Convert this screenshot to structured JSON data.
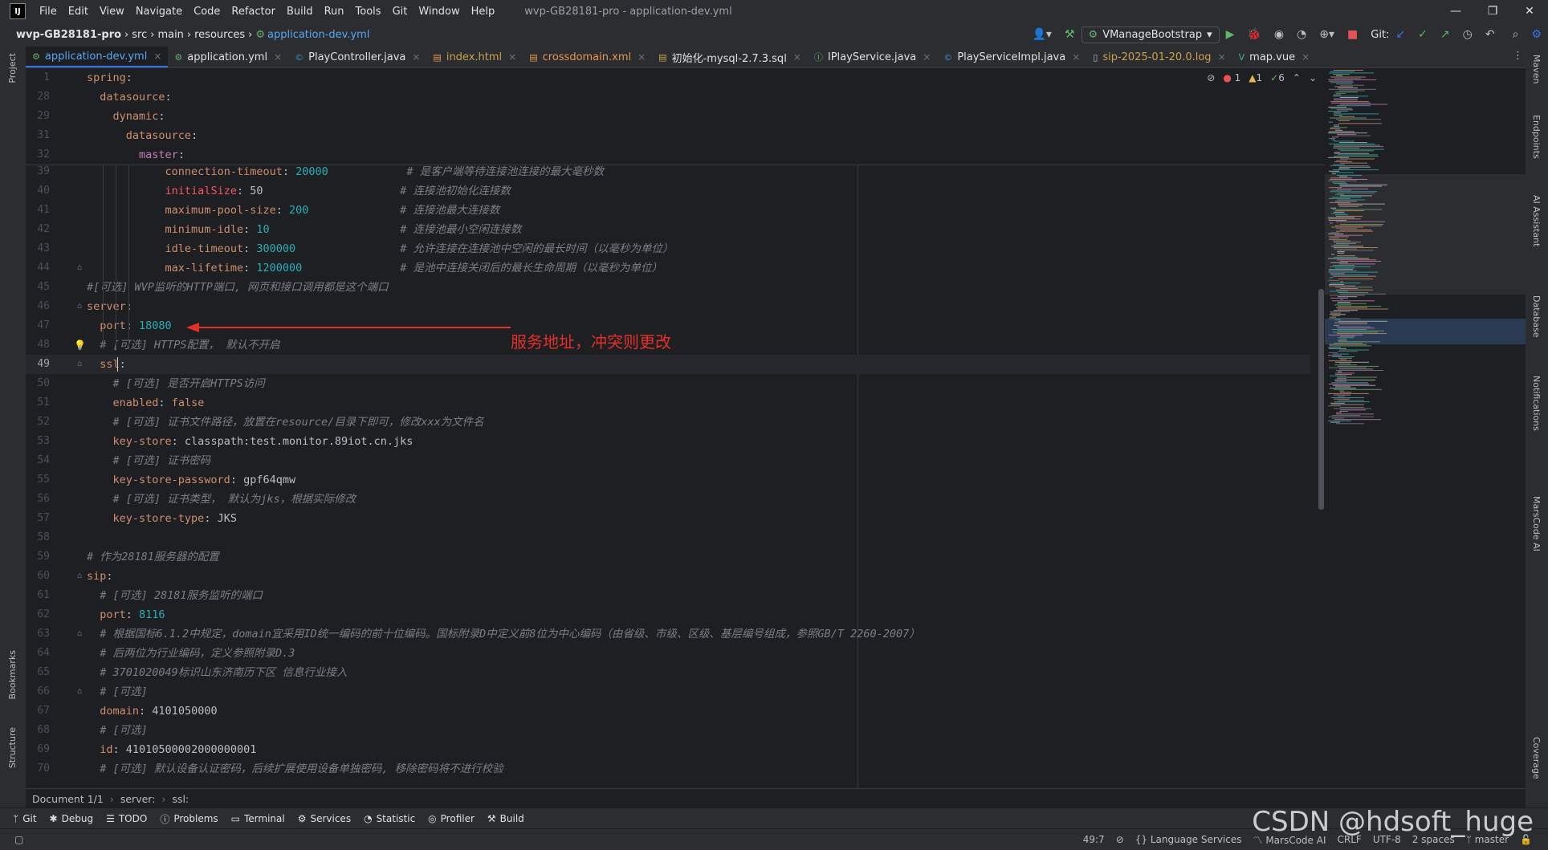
{
  "titlebar": {
    "logo": "IJ",
    "menu": [
      "File",
      "Edit",
      "View",
      "Navigate",
      "Code",
      "Refactor",
      "Build",
      "Run",
      "Tools",
      "Git",
      "Window",
      "Help"
    ],
    "window_title": "wvp-GB28181-pro - application-dev.yml",
    "controls": [
      "—",
      "❐",
      "✕"
    ]
  },
  "navbar": {
    "project": "wvp-GB28181-pro",
    "path": [
      "src",
      "main",
      "resources"
    ],
    "file": "application-dev.yml",
    "run_config": "VManageBootstrap",
    "git_label": "Git:"
  },
  "tabs": [
    {
      "label": "application-dev.yml",
      "icon": "yaml-icon",
      "color": "#55a8f5",
      "active": true
    },
    {
      "label": "application.yml",
      "icon": "yaml-icon",
      "color": "#dfe1e5",
      "active": false
    },
    {
      "label": "PlayController.java",
      "icon": "class-icon",
      "color": "#dfe1e5",
      "active": false
    },
    {
      "label": "index.html",
      "icon": "html-icon",
      "color": "#c9a349",
      "active": false
    },
    {
      "label": "crossdomain.xml",
      "icon": "xml-icon",
      "color": "#e8954d",
      "active": false
    },
    {
      "label": "初始化-mysql-2.7.3.sql",
      "icon": "sql-icon",
      "color": "#dfe1e5",
      "active": false
    },
    {
      "label": "IPlayService.java",
      "icon": "interface-icon",
      "color": "#dfe1e5",
      "active": false
    },
    {
      "label": "PlayServiceImpl.java",
      "icon": "class-icon",
      "color": "#dfe1e5",
      "active": false
    },
    {
      "label": "sip-2025-01-20.0.log",
      "icon": "log-icon",
      "color": "#c9a349",
      "active": false
    },
    {
      "label": "map.vue",
      "icon": "vue-icon",
      "color": "#dfe1e5",
      "active": false
    }
  ],
  "inspections": {
    "errors": "1",
    "warnings": "1",
    "ok": "6"
  },
  "sticky_lines": [
    {
      "n": "1",
      "segs": [
        [
          "k",
          "spring"
        ],
        [
          "p",
          ":"
        ]
      ]
    },
    {
      "n": "28",
      "segs": [
        [
          "p",
          "  "
        ],
        [
          "k",
          "datasource"
        ],
        [
          "p",
          ":"
        ]
      ]
    },
    {
      "n": "29",
      "segs": [
        [
          "p",
          "    "
        ],
        [
          "k",
          "dynamic"
        ],
        [
          "p",
          ":"
        ]
      ]
    },
    {
      "n": "31",
      "segs": [
        [
          "p",
          "      "
        ],
        [
          "k",
          "datasource"
        ],
        [
          "p",
          ":"
        ]
      ]
    },
    {
      "n": "32",
      "segs": [
        [
          "p",
          "        "
        ],
        [
          "kp",
          "master"
        ],
        [
          "p",
          ":"
        ]
      ]
    }
  ],
  "lines": [
    {
      "n": "39",
      "segs": [
        [
          "p",
          "            "
        ],
        [
          "k",
          "connection-timeout"
        ],
        [
          "p",
          ": "
        ],
        [
          "n",
          "20000"
        ],
        [
          "p",
          "            "
        ],
        [
          "c",
          "# 是客户端等待连接池连接的最大毫秒数"
        ]
      ]
    },
    {
      "n": "40",
      "segs": [
        [
          "p",
          "            "
        ],
        [
          "err",
          "initialSize"
        ],
        [
          "p",
          ": 50                     "
        ],
        [
          "c",
          "# 连接池初始化连接数"
        ]
      ]
    },
    {
      "n": "41",
      "segs": [
        [
          "p",
          "            "
        ],
        [
          "k",
          "maximum-pool-size"
        ],
        [
          "p",
          ": "
        ],
        [
          "n",
          "200"
        ],
        [
          "p",
          "              "
        ],
        [
          "c",
          "# 连接池最大连接数"
        ]
      ]
    },
    {
      "n": "42",
      "segs": [
        [
          "p",
          "            "
        ],
        [
          "k",
          "minimum-idle"
        ],
        [
          "p",
          ": "
        ],
        [
          "n",
          "10"
        ],
        [
          "p",
          "                    "
        ],
        [
          "c",
          "# 连接池最小空闲连接数"
        ]
      ]
    },
    {
      "n": "43",
      "segs": [
        [
          "p",
          "            "
        ],
        [
          "k",
          "idle-timeout"
        ],
        [
          "p",
          ": "
        ],
        [
          "n",
          "300000"
        ],
        [
          "p",
          "                "
        ],
        [
          "c",
          "# 允许连接在连接池中空闲的最长时间（以毫秒为单位）"
        ]
      ]
    },
    {
      "n": "44",
      "segs": [
        [
          "p",
          "            "
        ],
        [
          "k",
          "max-lifetime"
        ],
        [
          "p",
          ": "
        ],
        [
          "n",
          "1200000"
        ],
        [
          "p",
          "               "
        ],
        [
          "c",
          "# 是池中连接关闭后的最长生命周期（以毫秒为单位）"
        ]
      ]
    },
    {
      "n": "45",
      "segs": [
        [
          "c",
          "#[可选] WVP监听的HTTP端口, 网页和接口调用都是这个端口"
        ]
      ]
    },
    {
      "n": "46",
      "segs": [
        [
          "k",
          "server"
        ],
        [
          "p",
          ":"
        ]
      ]
    },
    {
      "n": "47",
      "segs": [
        [
          "p",
          "  "
        ],
        [
          "k",
          "port"
        ],
        [
          "p",
          ": "
        ],
        [
          "n",
          "18080"
        ]
      ]
    },
    {
      "n": "48",
      "segs": [
        [
          "p",
          "  "
        ],
        [
          "c",
          "# [可选] HTTPS配置， 默认不开启"
        ]
      ]
    },
    {
      "n": "49",
      "segs": [
        [
          "p",
          "  "
        ],
        [
          "k",
          "ssl"
        ],
        [
          "p",
          ":"
        ]
      ]
    },
    {
      "n": "50",
      "segs": [
        [
          "p",
          "    "
        ],
        [
          "c",
          "# [可选] 是否开启HTTPS访问"
        ]
      ]
    },
    {
      "n": "51",
      "segs": [
        [
          "p",
          "    "
        ],
        [
          "k",
          "enabled"
        ],
        [
          "p",
          ": "
        ],
        [
          "k",
          "false"
        ]
      ]
    },
    {
      "n": "52",
      "segs": [
        [
          "p",
          "    "
        ],
        [
          "c",
          "# [可选] 证书文件路径，放置在resource/目录下即可，修改xxx为文件名"
        ]
      ]
    },
    {
      "n": "53",
      "segs": [
        [
          "p",
          "    "
        ],
        [
          "k",
          "key-store"
        ],
        [
          "p",
          ": classpath:test.monitor.89iot.cn.jks"
        ]
      ]
    },
    {
      "n": "54",
      "segs": [
        [
          "p",
          "    "
        ],
        [
          "c",
          "# [可选] 证书密码"
        ]
      ]
    },
    {
      "n": "55",
      "segs": [
        [
          "p",
          "    "
        ],
        [
          "k",
          "key-store-password"
        ],
        [
          "p",
          ": gpf64qmw"
        ]
      ]
    },
    {
      "n": "56",
      "segs": [
        [
          "p",
          "    "
        ],
        [
          "c",
          "# [可选] 证书类型， 默认为jks，根据实际修改"
        ]
      ]
    },
    {
      "n": "57",
      "segs": [
        [
          "p",
          "    "
        ],
        [
          "k",
          "key-store-type"
        ],
        [
          "p",
          ": JKS"
        ]
      ]
    },
    {
      "n": "58",
      "segs": []
    },
    {
      "n": "59",
      "segs": [
        [
          "c",
          "# 作为28181服务器的配置"
        ]
      ]
    },
    {
      "n": "60",
      "segs": [
        [
          "k",
          "sip"
        ],
        [
          "p",
          ":"
        ]
      ]
    },
    {
      "n": "61",
      "segs": [
        [
          "p",
          "  "
        ],
        [
          "c",
          "# [可选] 28181服务监听的端口"
        ]
      ]
    },
    {
      "n": "62",
      "segs": [
        [
          "p",
          "  "
        ],
        [
          "k",
          "port"
        ],
        [
          "p",
          ": "
        ],
        [
          "n",
          "8116"
        ]
      ]
    },
    {
      "n": "63",
      "segs": [
        [
          "p",
          "  "
        ],
        [
          "c",
          "# 根据国标6.1.2中规定，domain宜采用ID统一编码的前十位编码。国标附录D中定义前8位为中心编码（由省级、市级、区级、基层编号组成，参照GB/T 2260-2007）"
        ]
      ]
    },
    {
      "n": "64",
      "segs": [
        [
          "p",
          "  "
        ],
        [
          "c",
          "# 后两位为行业编码，定义参照附录D.3"
        ]
      ]
    },
    {
      "n": "65",
      "segs": [
        [
          "p",
          "  "
        ],
        [
          "c",
          "# 3701020049标识山东济南历下区 信息行业接入"
        ]
      ]
    },
    {
      "n": "66",
      "segs": [
        [
          "p",
          "  "
        ],
        [
          "c",
          "# [可选]"
        ]
      ]
    },
    {
      "n": "67",
      "segs": [
        [
          "p",
          "  "
        ],
        [
          "k",
          "domain"
        ],
        [
          "p",
          ": 4101050000"
        ]
      ]
    },
    {
      "n": "68",
      "segs": [
        [
          "p",
          "  "
        ],
        [
          "c",
          "# [可选]"
        ]
      ]
    },
    {
      "n": "69",
      "segs": [
        [
          "p",
          "  "
        ],
        [
          "k",
          "id"
        ],
        [
          "p",
          ": 41010500002000000001"
        ]
      ]
    },
    {
      "n": "70",
      "segs": [
        [
          "p",
          "  "
        ],
        [
          "c",
          "# [可选] 默认设备认证密码，后续扩展使用设备单独密码, 移除密码将不进行校验"
        ]
      ]
    }
  ],
  "annotation": {
    "text": "服务地址，冲突则更改",
    "color": "#e5302a"
  },
  "bottom_breadcrumb": [
    "Document 1/1",
    "server:",
    "ssl:"
  ],
  "tool_windows": [
    "Git",
    "Debug",
    "TODO",
    "Problems",
    "Terminal",
    "Services",
    "Statistic",
    "Profiler",
    "Build"
  ],
  "left_tools": [
    "Project",
    "Bookmarks",
    "Structure"
  ],
  "right_tools": [
    "Maven",
    "Endpoints",
    "AI Assistant",
    "Database",
    "Notifications",
    "MarsCode AI",
    "Coverage"
  ],
  "status": {
    "position": "49:7",
    "language_services": "Language Services",
    "marscode": "MarsCode AI",
    "line_sep": "CRLF",
    "encoding": "UTF-8",
    "indent": "2 spaces",
    "branch": "master"
  },
  "watermark": "CSDN @hdsoft_huge"
}
